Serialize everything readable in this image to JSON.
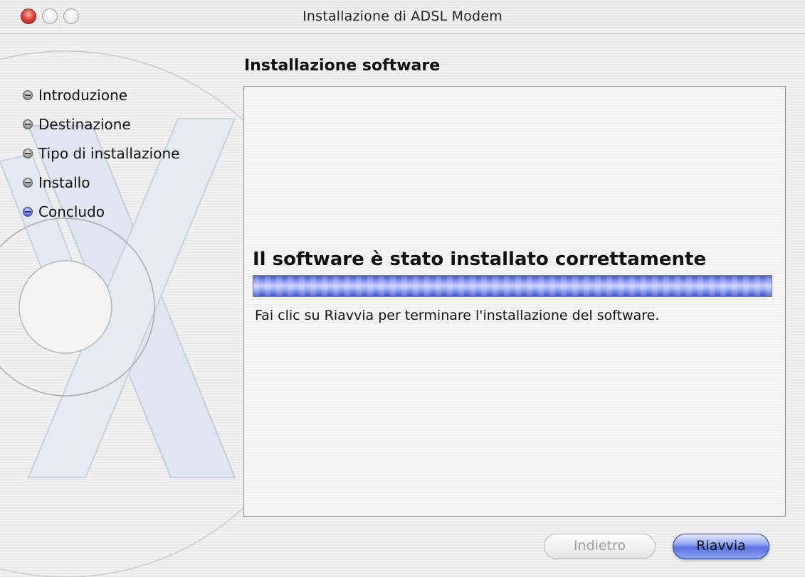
{
  "window": {
    "title": "Installazione di ADSL Modem"
  },
  "sidebar": {
    "steps": [
      {
        "label": "Introduzione",
        "active": false
      },
      {
        "label": "Destinazione",
        "active": false
      },
      {
        "label": "Tipo di installazione",
        "active": false
      },
      {
        "label": "Installo",
        "active": false
      },
      {
        "label": "Concludo",
        "active": true
      }
    ]
  },
  "main": {
    "section_title": "Installazione software",
    "status_heading": "Il software è stato installato correttamente",
    "progress_fraction": 1.0,
    "status_text": "Fai clic su Riavvia per terminare l'installazione del software."
  },
  "buttons": {
    "back_label": "Indietro",
    "restart_label": "Riavvia"
  },
  "colors": {
    "accent": "#5a72e0",
    "close_button": "#e0463b"
  }
}
